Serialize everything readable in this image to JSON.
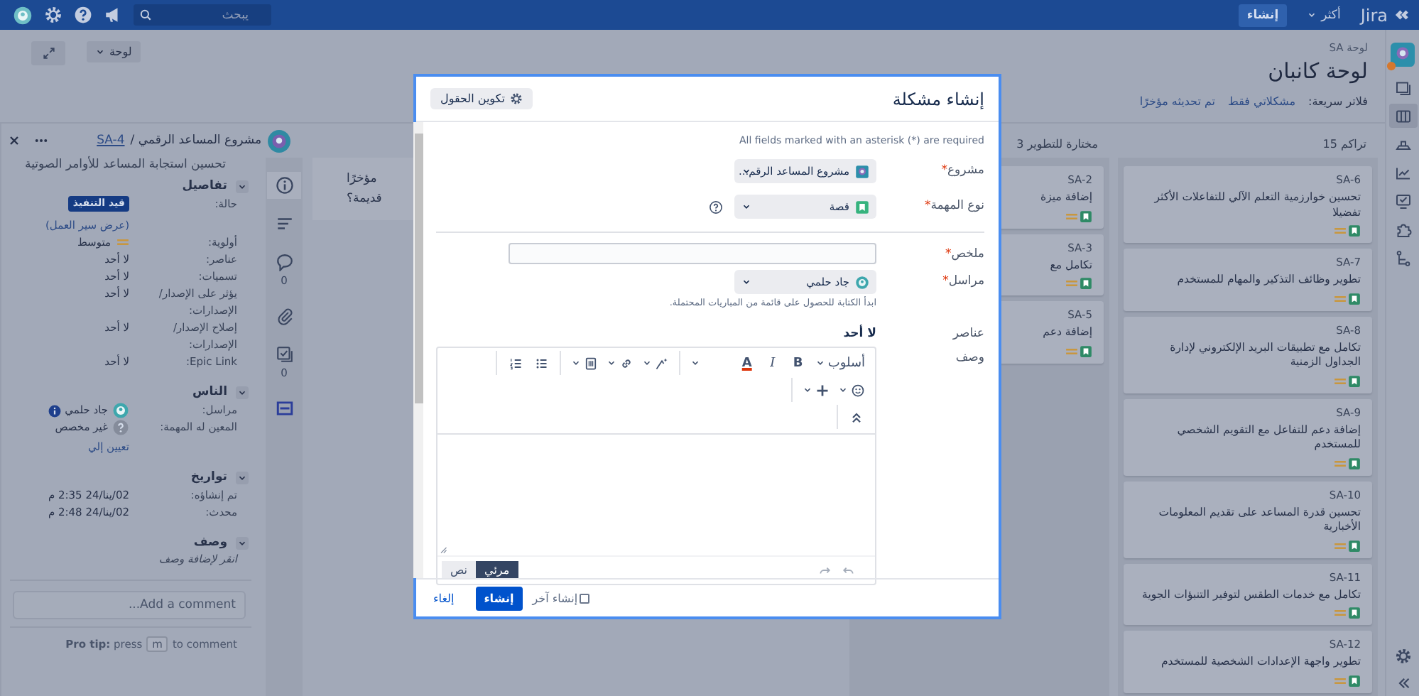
{
  "top_bar": {
    "logo": "Jira",
    "more_menu": "أكثر",
    "create_button": "إنشاء",
    "search": {
      "placeholder": "يبحث"
    }
  },
  "sidebar": {
    "items": [
      {
        "kind": "roadmap",
        "selected": false
      },
      {
        "kind": "board",
        "selected": true
      },
      {
        "kind": "releases",
        "selected": false
      },
      {
        "kind": "reports",
        "selected": false
      },
      {
        "kind": "issues",
        "selected": false
      },
      {
        "kind": "components",
        "selected": false
      },
      {
        "kind": "code",
        "selected": false
      }
    ]
  },
  "board_header": {
    "breadcrumb": "لوحة SA",
    "title": "لوحة كانبان",
    "quick_filters_label": "فلاتر سريعة:",
    "quick_filters": [
      {
        "label": "مشكلاتي فقط",
        "selected": false
      },
      {
        "label": "تم تحديثه مؤخرًا",
        "selected": false
      }
    ],
    "board_menu": "لوحة"
  },
  "columns": [
    {
      "title": "تراكم 15",
      "cards": [
        {
          "key": "SA-6",
          "summary": "تحسين خوارزمية التعلم الآلي للتفاعلات الأكثر تفضيلا"
        },
        {
          "key": "SA-7",
          "summary": "تطوير وظائف التذكير والمهام للمستخدم"
        },
        {
          "key": "SA-8",
          "summary": "تكامل مع تطبيقات البريد الإلكتروني لإدارة الجداول الزمنية"
        },
        {
          "key": "SA-9",
          "summary": "إضافة دعم للتفاعل مع التقويم الشخصي للمستخدم"
        },
        {
          "key": "SA-10",
          "summary": "تحسين قدرة المساعد على تقديم المعلومات الأخبارية"
        },
        {
          "key": "SA-11",
          "summary": "تكامل مع خدمات الطقس لتوفير التنبؤات الجوية"
        },
        {
          "key": "SA-12",
          "summary": "تطوير واجهة الإعدادات الشخصية للمستخدم"
        }
      ]
    },
    {
      "title": "مختارة للتطوير 3",
      "cards": [
        {
          "key": "SA-2",
          "summary": "إضافة ميزة"
        },
        {
          "key": "SA-3",
          "summary": "تكامل مع"
        },
        {
          "key": "SA-5",
          "summary": "إضافة دعم"
        }
      ]
    }
  ],
  "hidden_column_message": {
    "lines": [
      "مؤخرًا",
      "قديمة؟"
    ]
  },
  "issue_panel": {
    "project": "مشروع المساعد الرقمي /",
    "key": "SA-4",
    "title": "تحسين استجابة المساعد للأوامر الصوتية",
    "tabs": [
      {
        "kind": "info",
        "selected": true
      },
      {
        "kind": "description",
        "selected": false
      },
      {
        "kind": "comments",
        "selected": false,
        "count": "0"
      },
      {
        "kind": "attachments",
        "selected": false
      },
      {
        "kind": "subtasks",
        "selected": false,
        "count": "0"
      },
      {
        "kind": "links",
        "selected": false
      }
    ],
    "sections": [
      {
        "title": "تفاصيل",
        "expanded": true,
        "rows": [
          {
            "label": "حالة:",
            "kind": "status",
            "value": "قيد التنفيذ",
            "link": "(عرض سير العمل)"
          },
          {
            "label": "أولوية:",
            "kind": "priority",
            "value": "متوسط"
          },
          {
            "label": "عناصر:",
            "kind": "text",
            "value": "لا أحد"
          },
          {
            "label": "تسميات:",
            "kind": "text",
            "value": "لا أحد"
          },
          {
            "label": "يؤثر على الإصدار/ الإصدارات:",
            "kind": "text",
            "value": "لا أحد"
          },
          {
            "label": "إصلاح الإصدار/ الإصدارات:",
            "kind": "text",
            "value": "لا أحد"
          },
          {
            "label": "Epic Link:",
            "kind": "text",
            "value": "لا أحد"
          }
        ]
      },
      {
        "title": "الناس",
        "expanded": true,
        "rows": [
          {
            "label": "مراسل:",
            "kind": "user",
            "value": "جاد حلمي"
          },
          {
            "label": "المعين له المهمة:",
            "kind": "unassigned",
            "value": "غير مخصص",
            "action": "تعيين إلي"
          }
        ]
      },
      {
        "title": "تواريخ",
        "expanded": true,
        "rows": [
          {
            "label": "تم إنشاؤه:",
            "kind": "text",
            "value": "02/ينا/24 2:35 م"
          },
          {
            "label": "محدث:",
            "kind": "text",
            "value": "02/ينا/24 2:48 م"
          }
        ]
      },
      {
        "title": "وصف",
        "expanded": true,
        "rows": [
          {
            "kind": "hint",
            "value": "انقر لإضافة وصف"
          }
        ]
      }
    ],
    "comment": {
      "placeholder": "Add a comment..."
    },
    "pro_tip": {
      "lead": "**Pro tip:** press",
      "key": "m",
      "trail": "to comment"
    }
  },
  "dialog": {
    "title": "إنشاء مشكلة",
    "configure_button": "تكوين الحقول",
    "required_note": "All fields marked with an asterisk (*) are required",
    "fields": [
      {
        "label": "مشروع",
        "required_mark": "*",
        "kind": "project-select",
        "value": "مشروع المساعد الرقم..."
      },
      {
        "label": "نوع المهمة",
        "required_mark": "*",
        "kind": "type-select",
        "value": "قصة",
        "has_help": true
      },
      {
        "kind": "divider"
      },
      {
        "label": "ملخص",
        "required_mark": "*",
        "kind": "text-input"
      },
      {
        "label": "مراسل",
        "required_mark": "*",
        "kind": "user-select",
        "value": "جاد حلمي",
        "hint": "ابدأ الكتابة للحصول على قائمة من المباريات المحتملة."
      },
      {
        "label": "عناصر",
        "kind": "static",
        "value": "لا أحد"
      },
      {
        "label": "وصف",
        "kind": "editor"
      }
    ],
    "editor": {
      "toolbar": [
        [
          [
            {
              "kind": "style",
              "label": "أسلوب"
            },
            {
              "kind": "bold",
              "label": "B"
            },
            {
              "kind": "italic",
              "label": "I"
            },
            {
              "kind": "text-color",
              "label": "A"
            },
            {
              "kind": "more"
            }
          ],
          [
            {
              "kind": "effects"
            },
            {
              "kind": "link"
            },
            {
              "kind": "attachment"
            }
          ],
          [
            {
              "kind": "bullet-list"
            },
            {
              "kind": "numbered-list"
            }
          ]
        ],
        [
          [
            {
              "kind": "emoji"
            },
            {
              "kind": "insert"
            }
          ]
        ],
        [
          [
            {
              "kind": "collapse"
            }
          ]
        ]
      ],
      "modes": [
        {
          "label": "مرئي",
          "selected": true
        },
        {
          "label": "نص",
          "selected": false
        }
      ]
    },
    "footer": {
      "create_another": {
        "label": "إنشاء آخر",
        "checked": false
      },
      "submit": "إنشاء",
      "cancel": "إلغاء"
    }
  }
}
